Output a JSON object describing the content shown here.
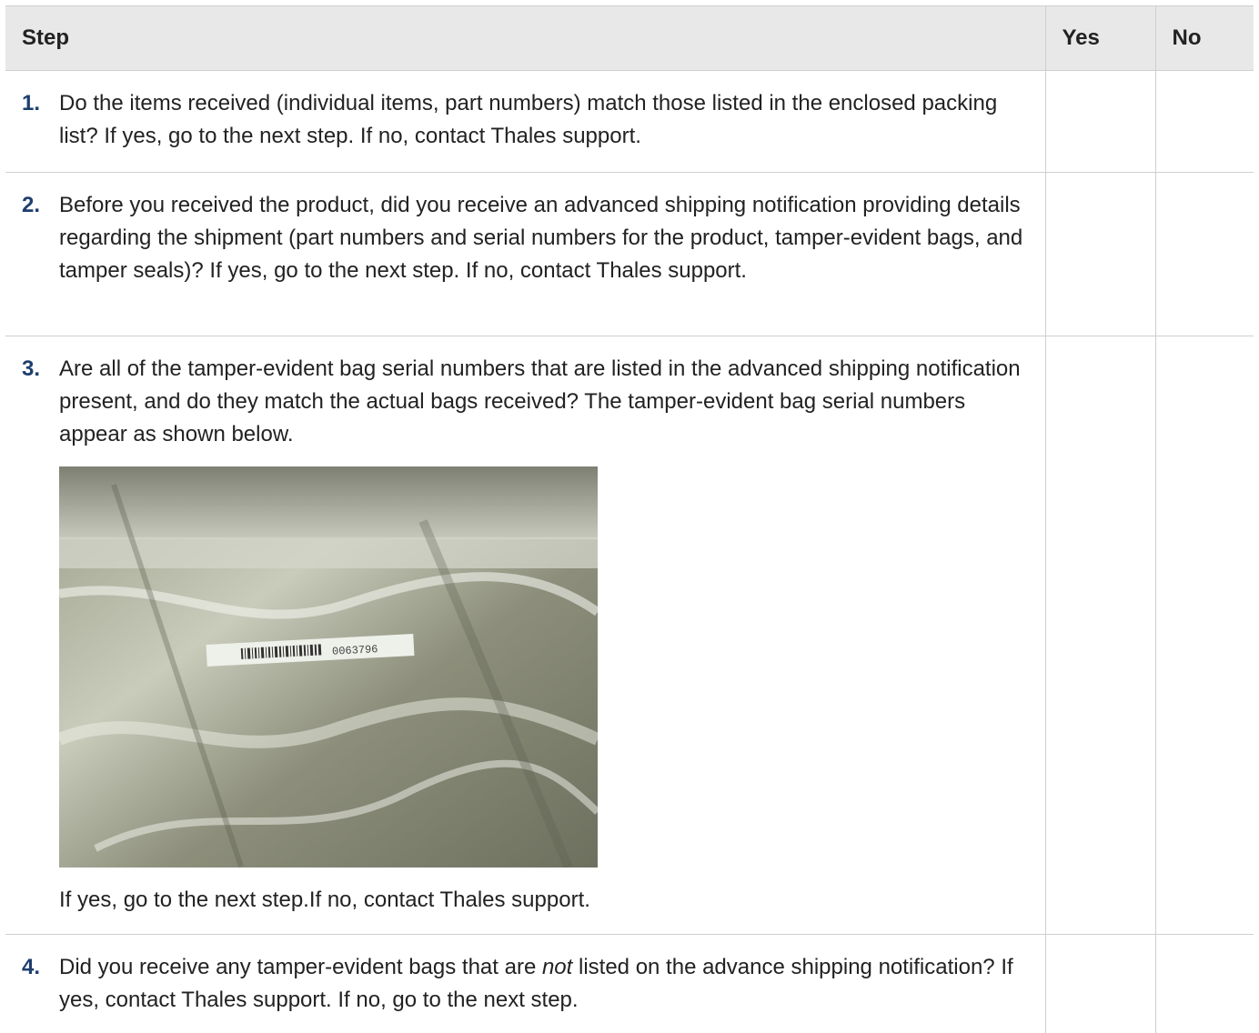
{
  "table": {
    "headers": {
      "step": "Step",
      "yes": "Yes",
      "no": "No"
    },
    "rows": [
      {
        "num": "1.",
        "text": "Do the items received (individual items, part numbers) match those listed in the enclosed packing list? If yes, go to the next step. If no, contact Thales support."
      },
      {
        "num": "2.",
        "text": "Before you received the product, did you receive an advanced shipping notification providing details regarding the shipment (part numbers and serial numbers for the product, tamper-evident bags, and tamper seals)? If yes, go to the next step. If no, contact Thales support."
      },
      {
        "num": "3.",
        "text": "Are all of the tamper-evident bag serial numbers that are listed in the advanced shipping notification present, and do they match the actual bags received? The tamper-evident bag serial numbers appear as shown below.",
        "image_label": "0063796",
        "after_text": "If yes, go to the next step.If no, contact Thales support."
      },
      {
        "num": "4.",
        "text_before": "Did you receive any tamper-evident bags that are ",
        "text_em": "not",
        "text_after": " listed on the advance shipping notification? If yes, contact Thales support. If no, go to the next step."
      }
    ]
  },
  "colors": {
    "header_bg": "#e8e8e8",
    "step_number": "#1d3f6e",
    "border": "#cfcfcf"
  }
}
